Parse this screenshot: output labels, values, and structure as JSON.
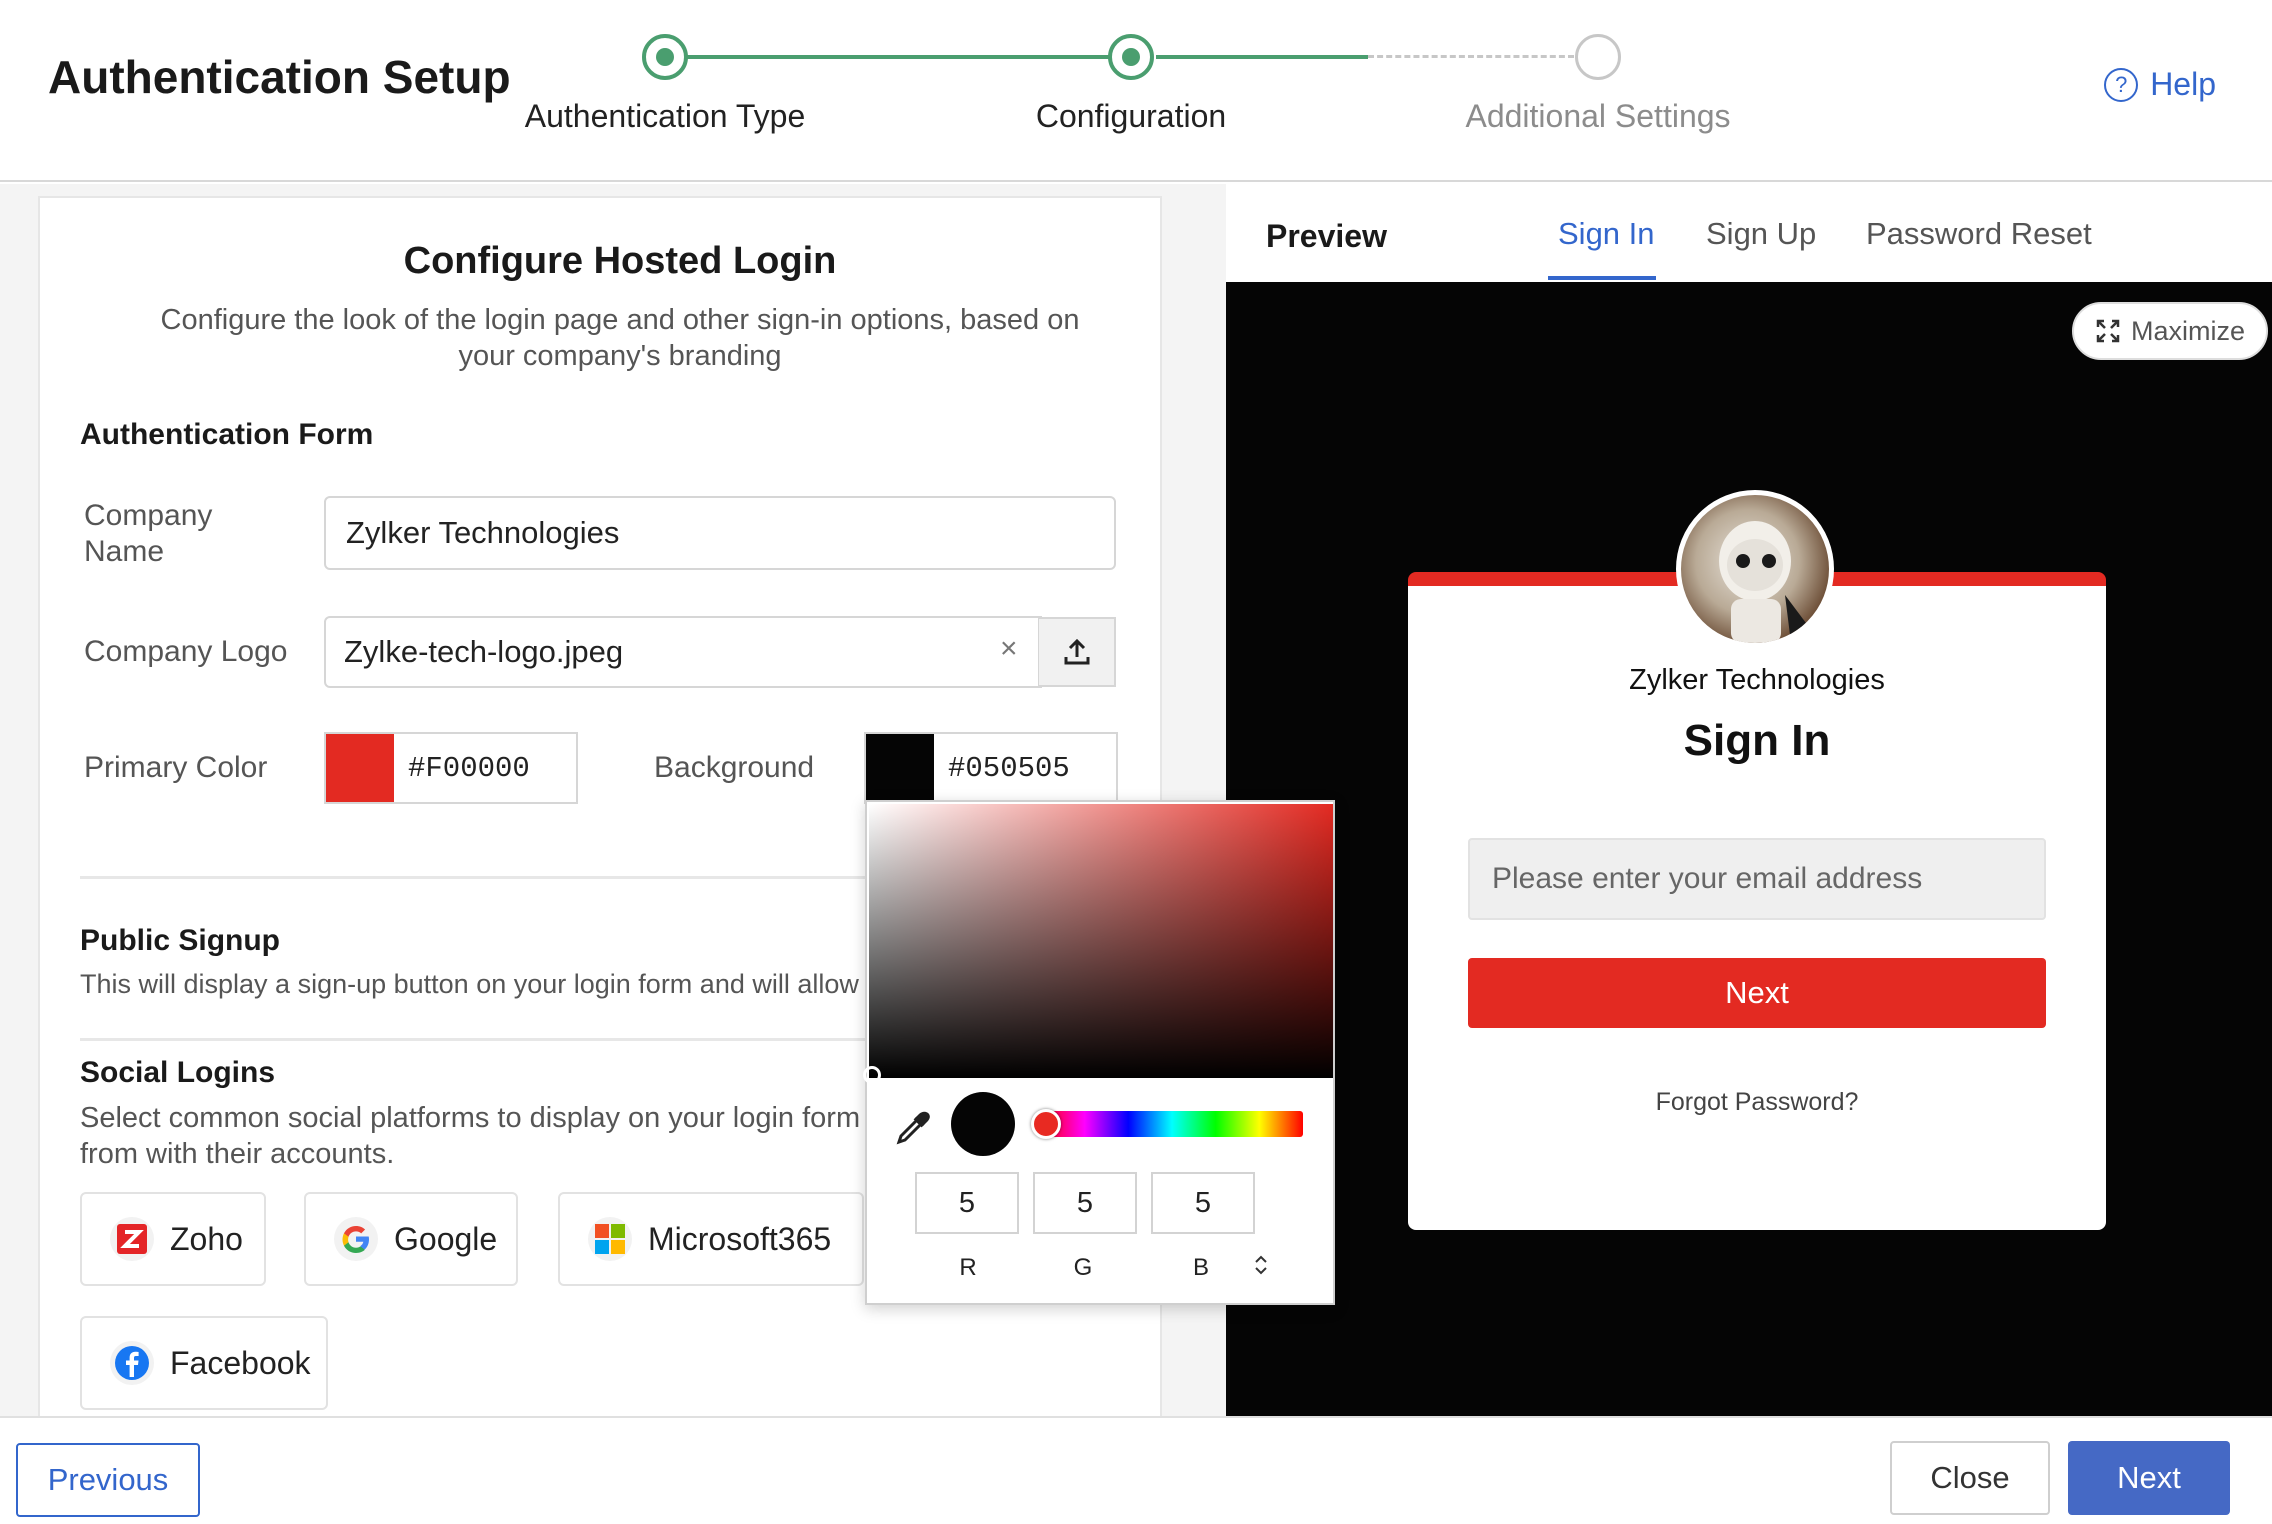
{
  "header": {
    "title": "Authentication Setup",
    "steps": [
      {
        "label": "Authentication Type",
        "state": "done"
      },
      {
        "label": "Configuration",
        "state": "current"
      },
      {
        "label": "Additional Settings",
        "state": "todo"
      }
    ],
    "help_icon": "?",
    "help_label": "Help"
  },
  "config": {
    "title": "Configure Hosted Login",
    "subtitle": "Configure the look of the login page and other sign-in options, based on your company's branding",
    "auth_form_heading": "Authentication Form",
    "company_name_label": "Company Name",
    "company_name_value": "Zylker Technologies",
    "company_logo_label": "Company Logo",
    "company_logo_value": "Zylke-tech-logo.jpeg",
    "clear_icon": "×",
    "primary_color_label": "Primary Color",
    "primary_color_value": "#F00000",
    "primary_swatch": "#e32a22",
    "background_label": "Background",
    "background_value": "#050505",
    "background_swatch": "#050505",
    "public_signup_heading": "Public Signup",
    "public_signup_text": "This will display a sign-up button on your login form and will allow soci",
    "social_heading": "Social Logins",
    "social_text_1": "Select common social platforms to display on your login form",
    "social_text_2": "from with their accounts.",
    "social_buttons": [
      "Zoho",
      "Google",
      "Microsoft365",
      "Facebook"
    ]
  },
  "color_picker": {
    "r": "5",
    "g": "5",
    "b": "5",
    "r_label": "R",
    "g_label": "G",
    "b_label": "B",
    "mode_toggle": "⌃⌄"
  },
  "preview": {
    "title": "Preview",
    "tabs": [
      "Sign In",
      "Sign Up",
      "Password Reset"
    ],
    "active_tab": "Sign In",
    "maximize_label": "Maximize",
    "company": "Zylker Technologies",
    "heading": "Sign In",
    "email_placeholder": "Please enter your email address",
    "next_label": "Next",
    "forgot_label": "Forgot Password?"
  },
  "footer": {
    "previous_label": "Previous",
    "close_label": "Close",
    "next_label": "Next"
  },
  "colors": {
    "accent": "#3366cc",
    "step_done": "#4a9e6f",
    "primary": "#e32a22",
    "background": "#050505"
  }
}
